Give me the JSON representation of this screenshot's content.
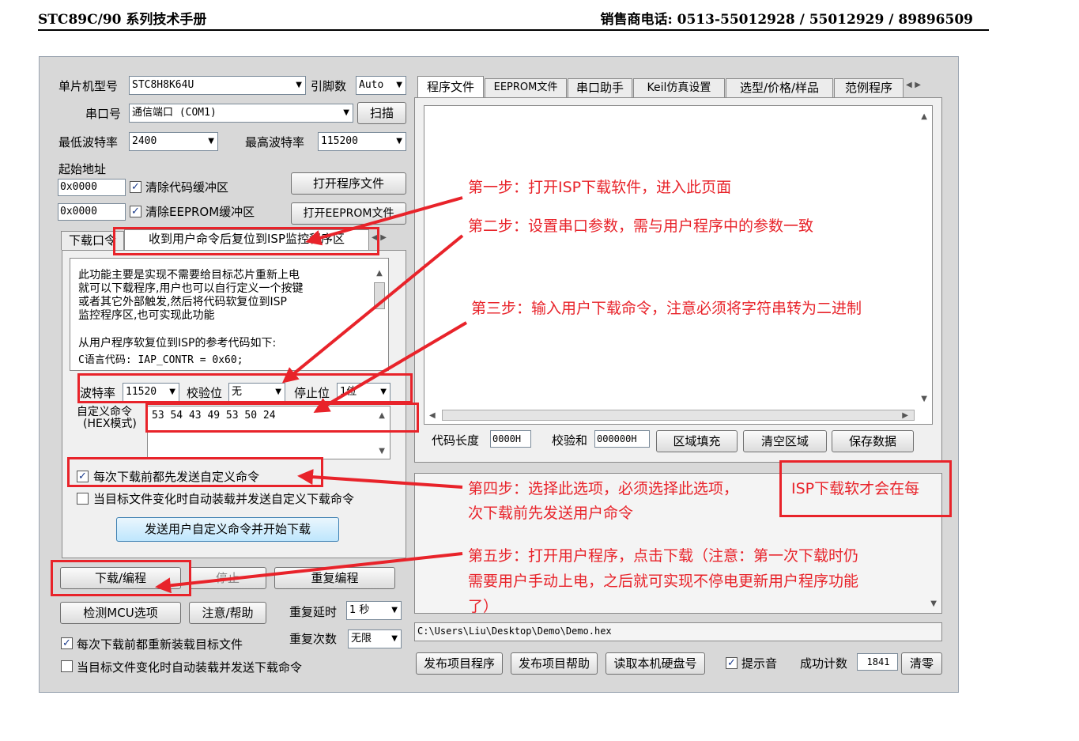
{
  "header": {
    "left": "STC89C/90 系列技术手册",
    "right": "销售商电话: 0513-55012928 / 55012929 / 89896509"
  },
  "left": {
    "mcu_label": "单片机型号",
    "mcu_value": "STC8H8K64U",
    "pins_label": "引脚数",
    "pins_value": "Auto",
    "port_label": "串口号",
    "port_value": "通信端口 (COM1)",
    "scan_button": "扫描",
    "min_baud_label": "最低波特率",
    "min_baud_value": "2400",
    "max_baud_label": "最高波特率",
    "max_baud_value": "115200",
    "start_addr_label": "起始地址",
    "addr1": "0x0000",
    "clear_code_label": "清除代码缓冲区",
    "open_program_button": "打开程序文件",
    "addr2": "0x0000",
    "clear_eeprom_label": "清除EEPROM缓冲区",
    "open_eeprom_button": "打开EEPROM文件"
  },
  "subtabs": [
    "下载口令",
    "收到用户命令后复位到ISP监控程序区"
  ],
  "desc_lines": [
    "此功能主要是实现不需要给目标芯片重新上电",
    "就可以下载程序,用户也可以自行定义一个按键",
    "或者其它外部触发,然后将代码软复位到ISP",
    "监控程序区,也可实现此功能"
  ],
  "ref_line": "从用户程序软复位到ISP的参考代码如下:",
  "c_line": "C语言代码: IAP_CONTR = 0x60;",
  "serial": {
    "baud_label": "波特率",
    "baud_value": "11520",
    "parity_label": "校验位",
    "parity_value": "无",
    "stop_label": "停止位",
    "stop_value": "1位"
  },
  "custom_cmd_label1": "自定义命令",
  "custom_cmd_label2": "(HEX模式)",
  "custom_cmd_value": "53 54 43 49 53 50 24",
  "opt_send_before": "每次下载前都先发送自定义命令",
  "opt_auto_send": "当目标文件变化时自动装载并发送自定义下载命令",
  "send_and_download_button": "发送用户自定义命令并开始下载",
  "download_button": "下载/编程",
  "stop_button": "停止",
  "reprogram_button": "重复编程",
  "check_mcu_button": "检测MCU选项",
  "help_button": "注意/帮助",
  "retry_delay_label": "重复延时",
  "retry_delay_value": "1 秒",
  "retry_count_label": "重复次数",
  "retry_count_value": "无限",
  "reload_label": "每次下载前都重新装载目标文件",
  "auto_load_label": "当目标文件变化时自动装载并发送下载命令",
  "right_tabs": [
    "程序文件",
    "EEPROM文件",
    "串口助手",
    "Keil仿真设置",
    "选型/价格/样品",
    "范例程序"
  ],
  "code_len_label": "代码长度",
  "code_len_value": "0000H",
  "checksum_label": "校验和",
  "checksum_value": "000000H",
  "fill_button": "区域填充",
  "clear_button": "清空区域",
  "save_button": "保存数据",
  "path": "C:\\Users\\Liu\\Desktop\\Demo\\Demo.hex",
  "publish_button": "发布项目程序",
  "publish_help_button": "发布项目帮助",
  "read_disk_button": "读取本机硬盘号",
  "beep_label": "提示音",
  "success_label": "成功计数",
  "success_value": "1841",
  "reset_button": "清零",
  "steps": {
    "s1": "第一步：打开ISP下载软件，进入此页面",
    "s2": "第二步：设置串口参数，需与用户程序中的参数一致",
    "s3": "第三步：输入用户下载命令，注意必须将字符串转为二进制",
    "s4a": "第四步：选择此选项，必须选择此选项，",
    "s4b": "ISP下载软才会在每",
    "s4c": "次下载前先发送用户命令",
    "s5a": "第五步：打开用户程序，点击下载（注意：第一次下载时仍",
    "s5b": "需要用户手动上电，之后就可实现不停电更新用户程序功能",
    "s5c": "了）"
  },
  "colors": {
    "annotation": "#e8232a",
    "window": "#d8d8d8"
  }
}
